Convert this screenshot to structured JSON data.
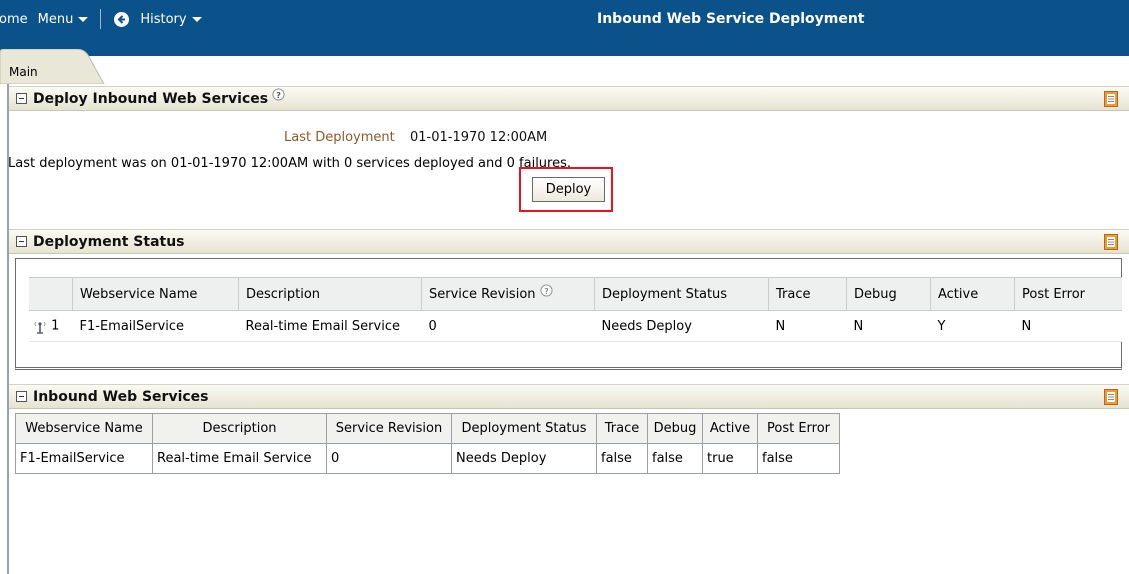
{
  "nav": {
    "home_label": "ome",
    "menu_label": "Menu",
    "history_label": "History",
    "back_icon": "back-arrow-icon"
  },
  "page_title": "Inbound Web Service Deployment",
  "tabs": [
    {
      "label": "Main"
    }
  ],
  "colors": {
    "topbar": "#0a5289",
    "highlight": "#e8141f",
    "label_brown": "#8a5a2b"
  },
  "sections": {
    "deploy": {
      "title": "Deploy Inbound Web Services",
      "last_deployment_label": "Last Deployment",
      "last_deployment_value": "01-01-1970 12:00AM",
      "message": "Last deployment was on 01-01-1970 12:00AM with 0 services deployed and 0 failures.",
      "deploy_button": "Deploy"
    },
    "status": {
      "title": "Deployment Status",
      "columns": [
        "Webservice Name",
        "Description",
        "Service Revision",
        "Deployment Status",
        "Trace",
        "Debug",
        "Active",
        "Post Error"
      ],
      "rows": [
        {
          "num": "1",
          "name": "F1-EmailService",
          "description": "Real-time Email Service",
          "revision": "0",
          "deployment_status": "Needs Deploy",
          "trace": "N",
          "debug": "N",
          "active": "Y",
          "post_error": "N"
        }
      ]
    },
    "inbound": {
      "title": "Inbound Web Services",
      "columns": [
        "Webservice Name",
        "Description",
        "Service Revision",
        "Deployment Status",
        "Trace",
        "Debug",
        "Active",
        "Post Error"
      ],
      "rows": [
        {
          "name": "F1-EmailService",
          "description": "Real-time Email Service",
          "revision": "0",
          "deployment_status": "Needs Deploy",
          "trace": "false",
          "debug": "false",
          "active": "true",
          "post_error": "false"
        }
      ]
    }
  }
}
